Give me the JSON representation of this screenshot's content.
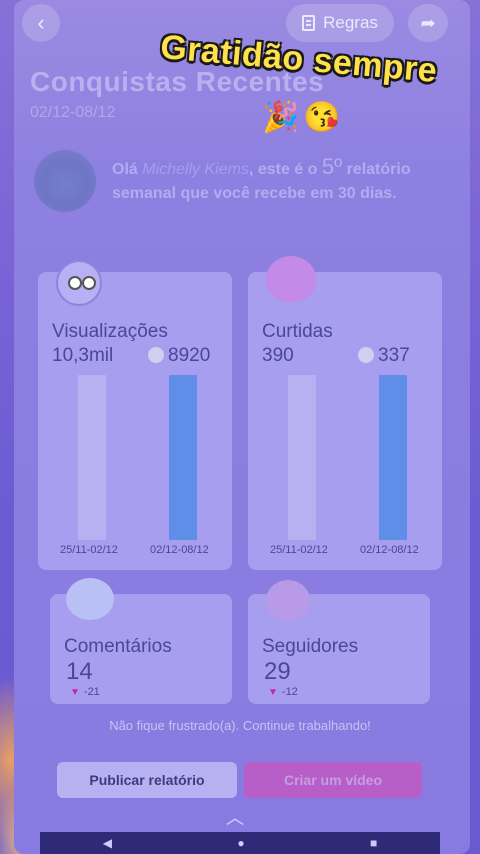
{
  "header": {
    "back_icon": "chevron-left-icon",
    "rules_label": "Regras",
    "share_icon": "share-icon"
  },
  "page": {
    "title": "Conquistas Recentes",
    "date_range": "02/12-08/12"
  },
  "overlay": {
    "text": "Gratidão sempre",
    "emojis": "🎉😘"
  },
  "greeting": {
    "prefix": "Olá ",
    "name": "Michelly Kiems",
    "middle": ", este é o ",
    "number": "5º",
    "suffix": " relatório semanal que você recebe em 30 dias."
  },
  "stats": {
    "views": {
      "label": "Visualizações",
      "previous": "10,3mil",
      "current": "8920",
      "prev_period": "25/11-02/12",
      "cur_period": "02/12-08/12"
    },
    "likes": {
      "label": "Curtidas",
      "previous": "390",
      "current": "337",
      "prev_period": "25/11-02/12",
      "cur_period": "02/12-08/12"
    },
    "comments": {
      "label": "Comentários",
      "value": "14",
      "delta": "-21"
    },
    "followers": {
      "label": "Seguidores",
      "value": "29",
      "delta": "-12"
    }
  },
  "footer": {
    "motivation": "Não fique frustrado(a). Continue trabalhando!",
    "publish_label": "Publicar relatório",
    "video_label": "Criar um vídeo"
  },
  "colors": {
    "overlay_text": "#ffe14a",
    "bar_current": "#5f8ee8",
    "bar_previous": "#b8b0f0",
    "delta_down": "#c02aa0"
  }
}
